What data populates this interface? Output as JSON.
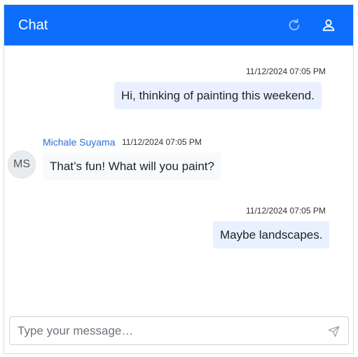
{
  "header": {
    "title": "Chat",
    "accent_color": "#0d6efd",
    "refresh_icon": "refresh-icon",
    "profile_icon": "user-icon"
  },
  "messages": [
    {
      "direction": "outgoing",
      "time": "11/12/2024 07:05 PM",
      "text": "Hi, thinking of painting this weekend."
    },
    {
      "direction": "incoming",
      "sender": "Michale Suyama",
      "initials": "MS",
      "time": "11/12/2024 07:05 PM",
      "text": "That’s fun! What will you paint?"
    },
    {
      "direction": "outgoing",
      "time": "11/12/2024 07:05 PM",
      "text": "Maybe landscapes."
    }
  ],
  "composer": {
    "placeholder": "Type your message…",
    "send_icon": "send-icon"
  }
}
